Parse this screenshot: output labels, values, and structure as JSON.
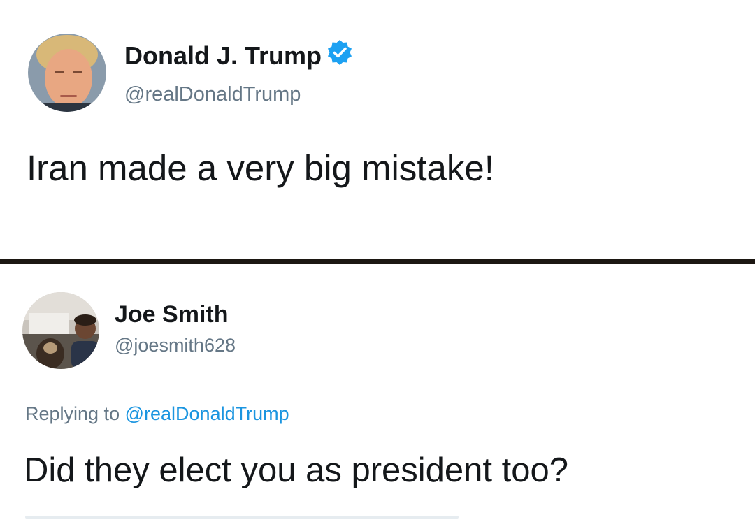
{
  "tweet": {
    "author_name": "Donald J. Trump",
    "author_handle": "@realDonaldTrump",
    "verified_icon": "verified-badge-icon",
    "text": "Iran made a very big mistake!"
  },
  "reply": {
    "author_name": "Joe Smith",
    "author_handle": "@joesmith628",
    "replying_prefix": "Replying to",
    "replying_to": "@realDonaldTrump",
    "text": "Did they elect you as president too?"
  },
  "colors": {
    "text": "#14171a",
    "secondary": "#657786",
    "link": "#1b95e0",
    "verified": "#1da1f2",
    "divider": "#1c1712"
  }
}
